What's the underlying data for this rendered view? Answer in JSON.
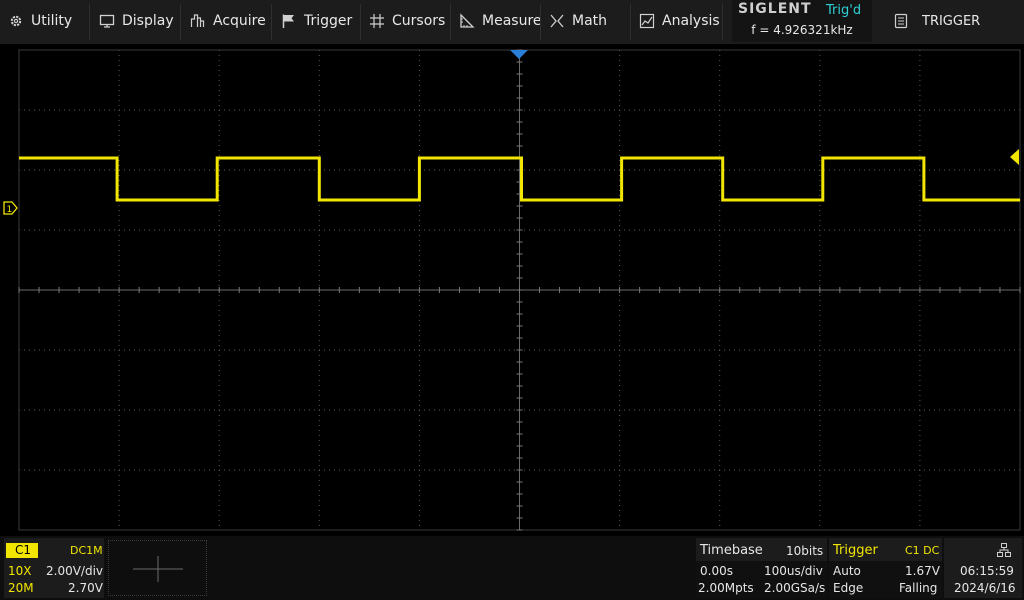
{
  "menu": {
    "utility": "Utility",
    "display": "Display",
    "acquire": "Acquire",
    "trigger": "Trigger",
    "cursors": "Cursors",
    "measure": "Measure",
    "math": "Math",
    "analysis": "Analysis"
  },
  "brand": {
    "logo": "SIGLENT",
    "status": "Trig'd",
    "frequency": "f = 4.926321kHz"
  },
  "trigger_button": "TRIGGER",
  "channel1": {
    "label": "C1",
    "coupling": "DC1M",
    "probe": "10X",
    "scale": "2.00V/div",
    "bandwidth": "20M",
    "offset": "2.70V",
    "marker": "1"
  },
  "timebase": {
    "title": "Timebase",
    "bits": "10bits",
    "delay": "0.00s",
    "scale": "100us/div",
    "memory": "2.00Mpts",
    "sample_rate": "2.00GSa/s"
  },
  "trigger": {
    "title": "Trigger",
    "source": "C1 DC",
    "mode": "Auto",
    "level": "1.67V",
    "type": "Edge",
    "slope": "Falling"
  },
  "clock": {
    "time": "06:15:59",
    "date": "2024/6/16"
  },
  "waveform": {
    "color": "#f2e600",
    "high_div": 1.8,
    "low_div": 0.15,
    "transitions_div": [
      0.98,
      1.98,
      3.0,
      4.0,
      5.02,
      6.02,
      7.03,
      8.03,
      9.04
    ],
    "first_level": "high"
  },
  "colors": {
    "channel1": "#f2e600",
    "status": "#2ed0d6",
    "grid": "#5a5a5a",
    "trigger_marker": "#2a7fd8"
  }
}
